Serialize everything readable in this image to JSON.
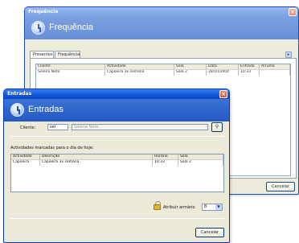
{
  "back_window": {
    "title": "Frequência",
    "header_title": "Frequência",
    "tabs": [
      "Presentes",
      "Frequência"
    ],
    "grid": {
      "headers": [
        "Cliente",
        "Actividade",
        "Sala",
        "Data",
        "Entrada",
        "Arruma"
      ],
      "rows": [
        [
          "Selena Neto",
          "Capoeira 3x semana",
          "Sala 2",
          "28/10/2004",
          "10:33",
          ""
        ]
      ]
    },
    "cancel_label": "Cancelar"
  },
  "front_window": {
    "title": "Entradas",
    "header_title": "Entradas",
    "client_label": "Cliente:",
    "client_code": "sel",
    "client_name": "Selena Neto",
    "section_label": "Actividades marcadas para o dia de hoje:",
    "grid": {
      "headers": [
        "Actividade",
        "Descrição",
        "Horário",
        "Sala"
      ],
      "rows": [
        [
          "Capoeira",
          "Capoeira 3x semana",
          "10:33",
          "Sala 2"
        ]
      ]
    },
    "locker_label": "Atribuir armário",
    "locker_value": "8",
    "cancel_label": "Cancelar"
  }
}
